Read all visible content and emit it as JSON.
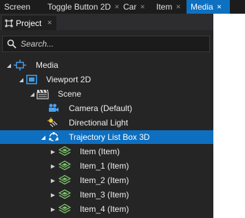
{
  "doc_tabs": [
    {
      "label": "Screen",
      "active": false,
      "closable": false
    },
    {
      "label": "Toggle Button 2D",
      "active": false,
      "closable": true
    },
    {
      "label": "Car",
      "active": false,
      "closable": true
    },
    {
      "label": "Item",
      "active": false,
      "closable": true
    },
    {
      "label": "Media",
      "active": true,
      "closable": true
    }
  ],
  "close_glyph": "✕",
  "panel": {
    "tab_label": "Project",
    "search": {
      "placeholder": "Search...",
      "value": ""
    }
  },
  "tree": {
    "media": {
      "label": "Media",
      "icon": "media-node-icon"
    },
    "viewport": {
      "label": "Viewport 2D",
      "icon": "viewport-icon"
    },
    "scene": {
      "label": "Scene",
      "icon": "scene-clapper-icon"
    },
    "camera": {
      "label": "Camera (Default)",
      "icon": "camera-icon"
    },
    "light": {
      "label": "Directional Light",
      "icon": "directional-light-icon"
    },
    "listbox": {
      "label": "Trajectory List Box 3D",
      "icon": "trajectory-list-icon",
      "selected": true
    },
    "items": [
      {
        "label": "Item (Item)",
        "icon": "item-node-icon"
      },
      {
        "label": "Item_1 (Item)",
        "icon": "item-node-icon"
      },
      {
        "label": "Item_2 (Item)",
        "icon": "item-node-icon"
      },
      {
        "label": "Item_3 (Item)",
        "icon": "item-node-icon"
      },
      {
        "label": "Item_4 (Item)",
        "icon": "item-node-icon"
      }
    ]
  },
  "colors": {
    "accent": "#0e70c0",
    "panel_bg": "#252526",
    "item_icon_green": "#7cc46a"
  }
}
